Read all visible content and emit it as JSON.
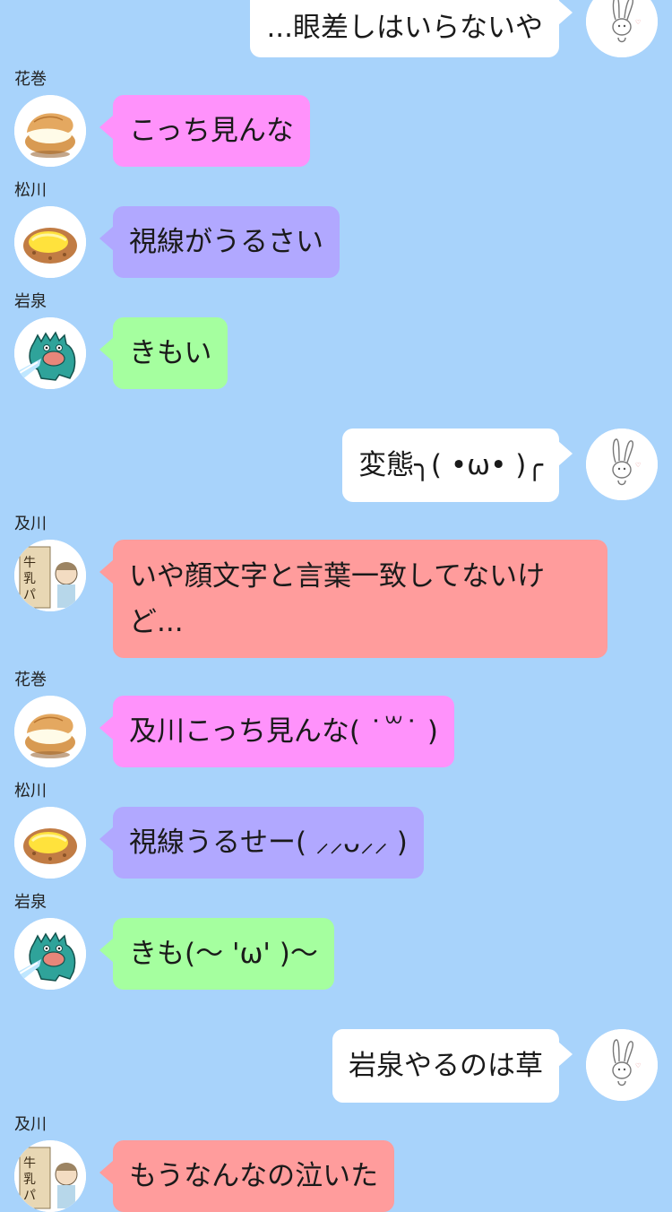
{
  "senders": {
    "hanamaki": {
      "name": "花巻",
      "avatar_icon": "cream-puff-icon",
      "bubble_color": "#ff92fb"
    },
    "matsukawa": {
      "name": "松川",
      "avatar_icon": "croquette-bread-icon",
      "bubble_color": "#b1a8ff"
    },
    "iwaizumi": {
      "name": "岩泉",
      "avatar_icon": "godzilla-icon",
      "bubble_color": "#a5ff9f"
    },
    "oikawa": {
      "name": "及川",
      "avatar_icon": "milk-bread-icon",
      "bubble_color": "#ff9c9c"
    },
    "self": {
      "avatar_icon": "rabbit-icon",
      "bubble_color": "#ffffff"
    }
  },
  "background_color": "#a8d3fb",
  "messages": [
    {
      "from": "self",
      "text": "...眼差しはいらないや"
    },
    {
      "from": "hanamaki",
      "name": "花巻",
      "text": "こっち見んな"
    },
    {
      "from": "matsukawa",
      "name": "松川",
      "text": "視線がうるさい"
    },
    {
      "from": "iwaizumi",
      "name": "岩泉",
      "text": "きもい"
    },
    {
      "from": "self",
      "text": "変態╮( •ω• )╭"
    },
    {
      "from": "oikawa",
      "name": "及川",
      "text": "いや顔文字と言葉一致してないけど..."
    },
    {
      "from": "hanamaki",
      "name": "花巻",
      "text": "及川こっち見んな( ˙꒳˙ )"
    },
    {
      "from": "matsukawa",
      "name": "松川",
      "text": "視線うるせー( ⸝⸝ᴗ⸝⸝ )"
    },
    {
      "from": "iwaizumi",
      "name": "岩泉",
      "text": "きも(〜 'ω' )〜"
    },
    {
      "from": "self",
      "text": "岩泉やるのは草"
    },
    {
      "from": "oikawa",
      "name": "及川",
      "text": "もうなんなの泣いた"
    }
  ]
}
